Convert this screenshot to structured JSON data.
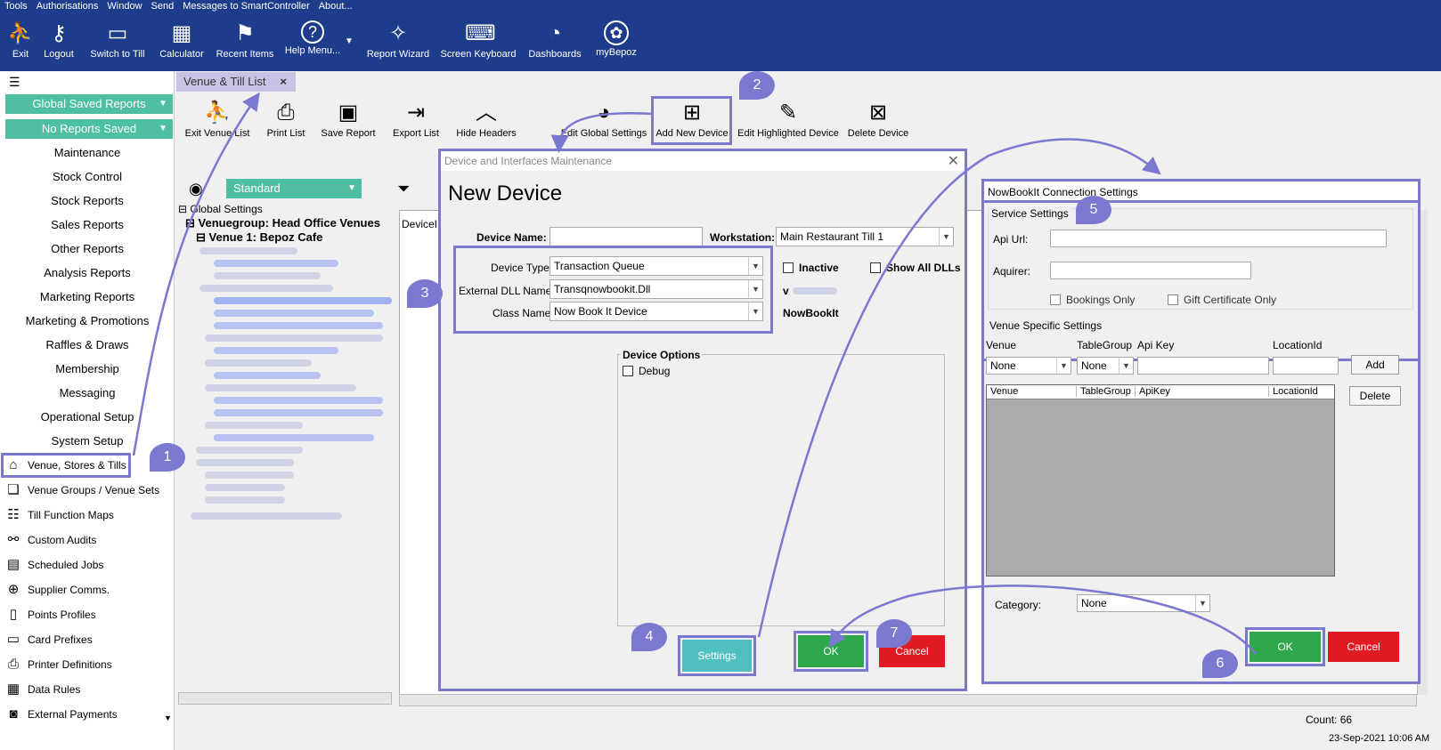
{
  "menubar": [
    "Tools",
    "Authorisations",
    "Window",
    "Send",
    "Messages to SmartController",
    "About..."
  ],
  "toolbar": [
    {
      "label": "Exit",
      "icon": "exit-icon",
      "glyph": "⛹"
    },
    {
      "label": "Logout",
      "icon": "key-icon",
      "glyph": "⚷"
    },
    {
      "label": "Switch to Till",
      "icon": "till-icon",
      "glyph": "▭"
    },
    {
      "label": "Calculator",
      "icon": "calculator-icon",
      "glyph": "▦"
    },
    {
      "label": "Recent Items",
      "icon": "recent-icon",
      "glyph": "⚑"
    },
    {
      "label": "Help Menu...",
      "icon": "help-icon",
      "glyph": "?"
    },
    {
      "label": "Report Wizard",
      "icon": "wizard-icon",
      "glyph": "✧"
    },
    {
      "label": "Screen Keyboard",
      "icon": "keyboard-icon",
      "glyph": "⌨"
    },
    {
      "label": "Dashboards",
      "icon": "dashboard-icon",
      "glyph": "◔"
    },
    {
      "label": "myBepoz",
      "icon": "mybepoz-icon",
      "glyph": "✿"
    }
  ],
  "sidebar": {
    "global_saved_reports": "Global Saved Reports",
    "no_reports_saved": "No Reports Saved",
    "links": [
      "Maintenance",
      "Stock Control",
      "Stock Reports",
      "Sales Reports",
      "Other Reports",
      "Analysis Reports",
      "Marketing Reports",
      "Marketing & Promotions",
      "Raffles & Draws",
      "Membership",
      "Messaging",
      "Operational Setup",
      "System Setup"
    ],
    "items": [
      {
        "label": "Venue, Stores & Tills",
        "icon": "venue-icon",
        "glyph": "⌂"
      },
      {
        "label": "Venue Groups / Venue Sets",
        "icon": "venue-groups-icon",
        "glyph": "❏"
      },
      {
        "label": "Till Function Maps",
        "icon": "function-map-icon",
        "glyph": "☷"
      },
      {
        "label": "Custom Audits",
        "icon": "audit-icon",
        "glyph": "⚯"
      },
      {
        "label": "Scheduled Jobs",
        "icon": "calendar-icon",
        "glyph": "▤"
      },
      {
        "label": "Supplier Comms.",
        "icon": "supplier-icon",
        "glyph": "⊕"
      },
      {
        "label": "Points Profiles",
        "icon": "points-icon",
        "glyph": "▯"
      },
      {
        "label": "Card Prefixes",
        "icon": "card-icon",
        "glyph": "▭"
      },
      {
        "label": "Printer Definitions",
        "icon": "printer-icon",
        "glyph": "⎙"
      },
      {
        "label": "Data Rules",
        "icon": "data-rules-icon",
        "glyph": "▦"
      },
      {
        "label": "External Payments",
        "icon": "payment-icon",
        "glyph": "◙"
      }
    ]
  },
  "tab": {
    "label": "Venue & Till List",
    "close": "×"
  },
  "main_toolbar": [
    {
      "label": "Exit Venue List",
      "icon": "exit-venue-icon",
      "glyph": "⛹"
    },
    {
      "label": "Print List",
      "icon": "print-icon",
      "glyph": "⎙"
    },
    {
      "label": "Save Report",
      "icon": "save-icon",
      "glyph": "▣"
    },
    {
      "label": "Export List",
      "icon": "export-icon",
      "glyph": "⇥"
    },
    {
      "label": "Hide Headers",
      "icon": "chevron-up-icon",
      "glyph": "︿"
    },
    {
      "label": "Edit Global Settings",
      "icon": "globe-icon",
      "glyph": "◕"
    },
    {
      "label": "Add New Device",
      "icon": "add-device-icon",
      "glyph": "⊞"
    },
    {
      "label": "Edit Highlighted Device",
      "icon": "edit-device-icon",
      "glyph": "✎"
    },
    {
      "label": "Delete Device",
      "icon": "delete-device-icon",
      "glyph": "⊠"
    }
  ],
  "view_select": "Standard",
  "tree": {
    "global": "Global Settings",
    "group": "Venuegroup: Head Office Venues",
    "venue": "Venue 1: Bepoz Cafe"
  },
  "grid": {
    "col": "DeviceI"
  },
  "dialog1": {
    "title": "Device and Interfaces Maintenance",
    "heading": "New Device",
    "device_name_label": "Device Name:",
    "device_name_value": "",
    "workstation_label": "Workstation:",
    "workstation_value": "Main Restaurant Till 1",
    "device_type_label": "Device Type:",
    "device_type_value": "Transaction Queue",
    "dll_label": "External DLL Name:",
    "dll_value": "Transqnowbookit.Dll",
    "class_label": "Class Name:",
    "class_value": "Now Book It Device",
    "inactive": "Inactive",
    "show_all_dlls": "Show All DLLs",
    "version_prefix": "v",
    "class_display": "NowBookIt",
    "options_title": "Device Options",
    "debug": "Debug",
    "settings_btn": "Settings",
    "ok_btn": "OK",
    "cancel_btn": "Cancel"
  },
  "dialog2": {
    "title": "NowBookIt Connection Settings",
    "service_settings": "Service Settings",
    "api_url_label": "Api Url:",
    "api_url_value": "",
    "aquirer_label": "Aquirer:",
    "aquirer_value": "",
    "bookings_only": "Bookings Only",
    "gift_cert_only": "Gift Certificate Only",
    "venue_specific": "Venue Specific Settings",
    "col_venue": "Venue",
    "col_tablegroup": "TableGroup",
    "col_apikey": "Api Key",
    "col_locationid": "LocationId",
    "venue_value": "None",
    "tablegroup_value": "None",
    "add_btn": "Add",
    "grid_venue": "Venue",
    "grid_tablegroup": "TableGroup",
    "grid_apikey": "ApiKey",
    "grid_locationid": "LocationId",
    "delete_btn": "Delete",
    "category_label": "Category:",
    "category_value": "None",
    "ok_btn": "OK",
    "cancel_btn": "Cancel"
  },
  "badges": [
    "1",
    "2",
    "3",
    "4",
    "5",
    "6",
    "7"
  ],
  "status": {
    "count": "Count: 66",
    "datetime": "23-Sep-2021  10:06 AM"
  },
  "colors": {
    "accent": "#7b78cf",
    "toolbar": "#1d3c8c",
    "green": "#2ea84a",
    "red": "#e01b24",
    "teal": "#4fbfa2"
  }
}
